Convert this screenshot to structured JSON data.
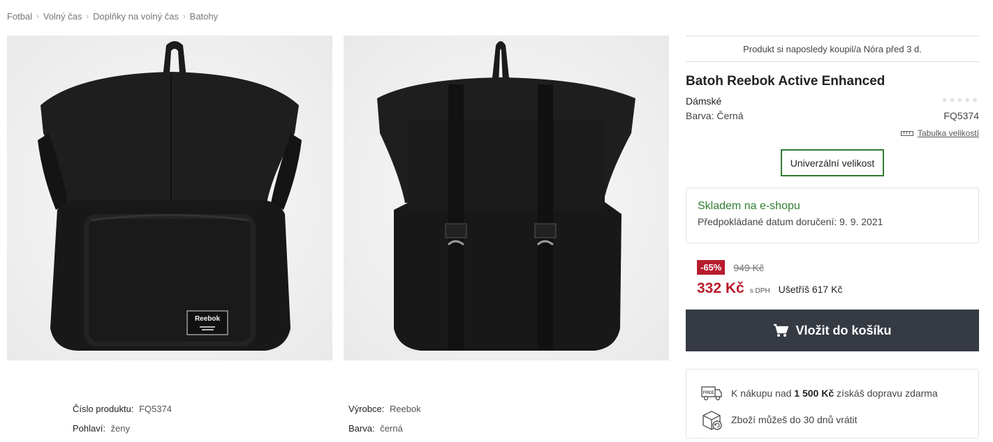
{
  "breadcrumb": [
    "Fotbal",
    "Volný čas",
    "Doplňky na volný čas",
    "Batohy"
  ],
  "breadcrumb_separator": "›",
  "product": {
    "last_bought": "Produkt si naposledy koupil/a Nóra před 3 d.",
    "title": "Batoh Reebok Active Enhanced",
    "gender": "Dámské",
    "color_line": "Barva: Černá",
    "code": "FQ5374",
    "rating_stars": "★★★★★",
    "size_table_label": "Tabulka velikostí",
    "size_option": "Univerzální velikost",
    "logo_text": "Reebok"
  },
  "stock": {
    "status": "Skladem na e-shopu",
    "delivery_label": "Předpokládané datum doručení:",
    "delivery_date": "9. 9. 2021"
  },
  "pricing": {
    "discount": "-65%",
    "old_price": "949 Kč",
    "price": "332 Kč",
    "vat_note": "s DPH",
    "savings": "Ušetříš 617 Kč"
  },
  "cart": {
    "label": "Vložit do košíku"
  },
  "benefits": {
    "free_shipping_prefix": "K nákupu nad",
    "free_shipping_amount": "1 500 Kč",
    "free_shipping_suffix": "získáš dopravu zdarma",
    "free_badge": "FREE",
    "returns": "Zboží můžeš do 30 dnů vrátit"
  },
  "specs": {
    "product_number_label": "Číslo produktu:",
    "product_number_value": "FQ5374",
    "gender_label": "Pohlaví:",
    "gender_value": "ženy",
    "manufacturer_label": "Výrobce:",
    "manufacturer_value": "Reebok",
    "color_label": "Barva:",
    "color_value": "černá"
  },
  "colors": {
    "accent_green": "#2e7d32",
    "price_red": "#b71c2c",
    "cart_button": "#353a43"
  }
}
